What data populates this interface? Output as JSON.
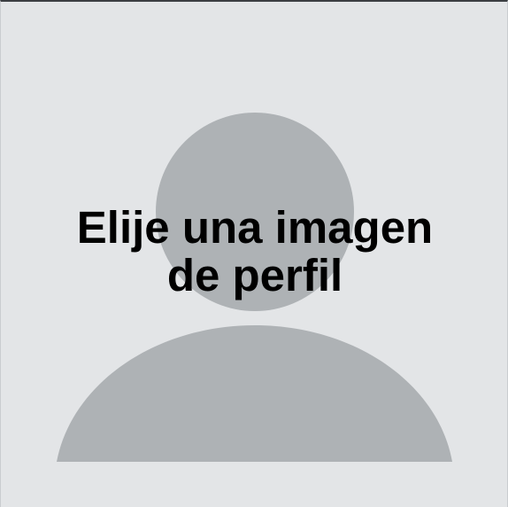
{
  "avatar_picker": {
    "prompt_line_1": "Elije una imagen",
    "prompt_line_2": "de perfil",
    "icon": "user-silhouette-icon",
    "colors": {
      "background": "#e3e5e7",
      "silhouette": "#aeb2b5",
      "text": "#000000",
      "top_border": "#3b3e42"
    }
  }
}
